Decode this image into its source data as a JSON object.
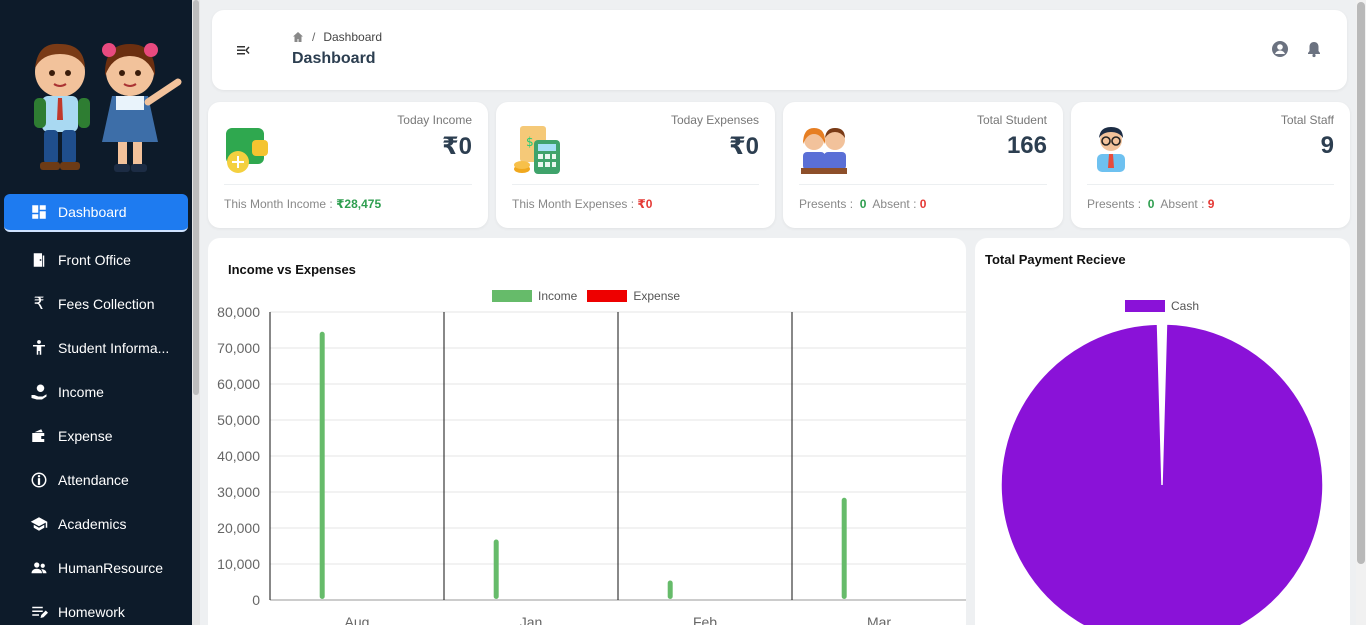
{
  "sidebar": {
    "items": [
      {
        "label": "Dashboard",
        "icon": "dashboard-icon",
        "active": true
      },
      {
        "label": "Front Office",
        "icon": "door-icon"
      },
      {
        "label": "Fees Collection",
        "icon": "rupee-icon"
      },
      {
        "label": "Student Informa...",
        "icon": "person-icon"
      },
      {
        "label": "Income",
        "icon": "hand-money-icon"
      },
      {
        "label": "Expense",
        "icon": "wallet-icon"
      },
      {
        "label": "Attendance",
        "icon": "attendance-icon"
      },
      {
        "label": "Academics",
        "icon": "graduation-cap-icon"
      },
      {
        "label": "HumanResource",
        "icon": "group-icon"
      },
      {
        "label": "Homework",
        "icon": "homework-icon"
      }
    ]
  },
  "header": {
    "breadcrumb": "Dashboard",
    "title": "Dashboard"
  },
  "cards": [
    {
      "label": "Today Income",
      "value": "₹0",
      "foot_label": "This Month Income :",
      "foot_value": "₹28,475"
    },
    {
      "label": "Today Expenses",
      "value": "₹0",
      "foot_label": "This Month Expenses :",
      "foot_value": "₹0"
    },
    {
      "label": "Total Student",
      "value": "166",
      "present_label": "Presents :",
      "present": "0",
      "absent_label": "Absent :",
      "absent": "0"
    },
    {
      "label": "Total Staff",
      "value": "9",
      "present_label": "Presents :",
      "present": "0",
      "absent_label": "Absent :",
      "absent": "9"
    }
  ],
  "colors": {
    "income": "#66bb6a",
    "expense": "#ee0000",
    "cash": "#8a12d8",
    "accent": "#1e7bf0"
  },
  "chart_data": [
    {
      "type": "bar",
      "title": "Income vs Expenses",
      "categories": [
        "Aug",
        "Jan",
        "Feb",
        "Mar"
      ],
      "series": [
        {
          "name": "Income",
          "values": [
            74500,
            16800,
            5400,
            28400
          ]
        },
        {
          "name": "Expense",
          "values": [
            0,
            0,
            0,
            0
          ]
        }
      ],
      "ylim": [
        0,
        80000
      ],
      "yticks": [
        "80,000",
        "70,000",
        "60,000",
        "50,000",
        "40,000",
        "30,000",
        "20,000",
        "10,000",
        "0"
      ],
      "legend": "top",
      "grid": true
    },
    {
      "type": "pie",
      "title": "Total Payment Recieve",
      "labels": [
        "Cash"
      ],
      "values": [
        100
      ],
      "legend": "top"
    }
  ]
}
